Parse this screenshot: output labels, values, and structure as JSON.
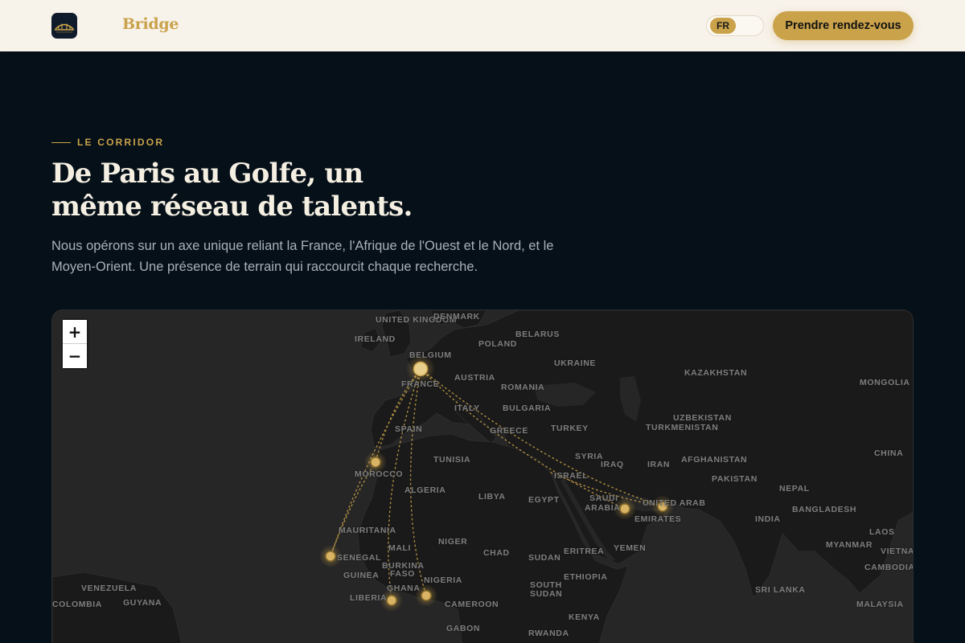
{
  "header": {
    "brand": "Bridge",
    "language": "FR",
    "cta_label": "Prendre rendez-vous"
  },
  "section": {
    "eyebrow": "LE CORRIDOR",
    "title_line1": "De Paris au Golfe, un",
    "title_line2": "même réseau de talents.",
    "lead_line1": "Nous opérons sur un axe unique reliant la France, l'Afrique de l'Ouest et le Nord, et le",
    "lead_line2": "Moyen-Orient. Une présence de terrain qui raccourcit chaque recherche."
  },
  "map": {
    "zoom_in": "+",
    "zoom_out": "−",
    "labels": {
      "united_kingdom": "United Kingdom",
      "ireland": "Ireland",
      "denmark": "Denmark",
      "belarus": "Belarus",
      "poland": "Poland",
      "belgium": "Belgium",
      "ukraine": "Ukraine",
      "kazakhstan": "Kazakhstan",
      "mongolia": "Mongolia",
      "austria": "Austria",
      "france": "France",
      "romania": "Romania",
      "italy": "Italy",
      "bulgaria": "Bulgaria",
      "uzbekistan": "Uzbekistan",
      "turkmenistan": "Turkmenistan",
      "spain": "Spain",
      "greece": "Greece",
      "turkey": "Turkey",
      "china": "China",
      "tunisia": "Tunisia",
      "syria": "Syria",
      "iraq": "Iraq",
      "iran": "Iran",
      "afghanistan": "Afghanistan",
      "morocco": "Morocco",
      "pakistan": "Pakistan",
      "algeria": "Algeria",
      "libya": "Libya",
      "egypt": "Egypt",
      "israel": "Israel",
      "nepal": "Nepal",
      "saudi": "Saudi",
      "arabia": "Arabia",
      "uae": "United Arab",
      "emirates": "Emirates",
      "bangladesh": "Bangladesh",
      "india": "India",
      "mauritania": "Mauritania",
      "mali": "Mali",
      "niger": "Niger",
      "chad": "Chad",
      "sudan": "Sudan",
      "eritrea": "Eritrea",
      "yemen": "Yemen",
      "laos": "Laos",
      "senegal": "Senegal",
      "burkina": "Burkina",
      "faso": "Faso",
      "myanmar": "Myanmar",
      "guinea": "Guinea",
      "nigeria": "Nigeria",
      "ethiopia": "Ethiopia",
      "vietnam": "Vietnam",
      "cambodia": "Cambodia",
      "venezuela": "Venezuela",
      "colombia": "Colombia",
      "guyana": "Guyana",
      "liberia": "Liberia",
      "ghana": "Ghana",
      "cameroon": "Cameroon",
      "south": "South",
      "south_sudan": "Sudan",
      "sri_lanka": "Sri Lanka",
      "malaysia": "Malaysia",
      "kenya": "Kenya",
      "gabon": "Gabon",
      "rwanda": "Rwanda"
    }
  },
  "colors": {
    "accent": "#c9a24a",
    "header_bg": "#f7f2ea",
    "page_bg": "#061019",
    "map_land": "#1a1a1a",
    "map_water": "#262626"
  }
}
